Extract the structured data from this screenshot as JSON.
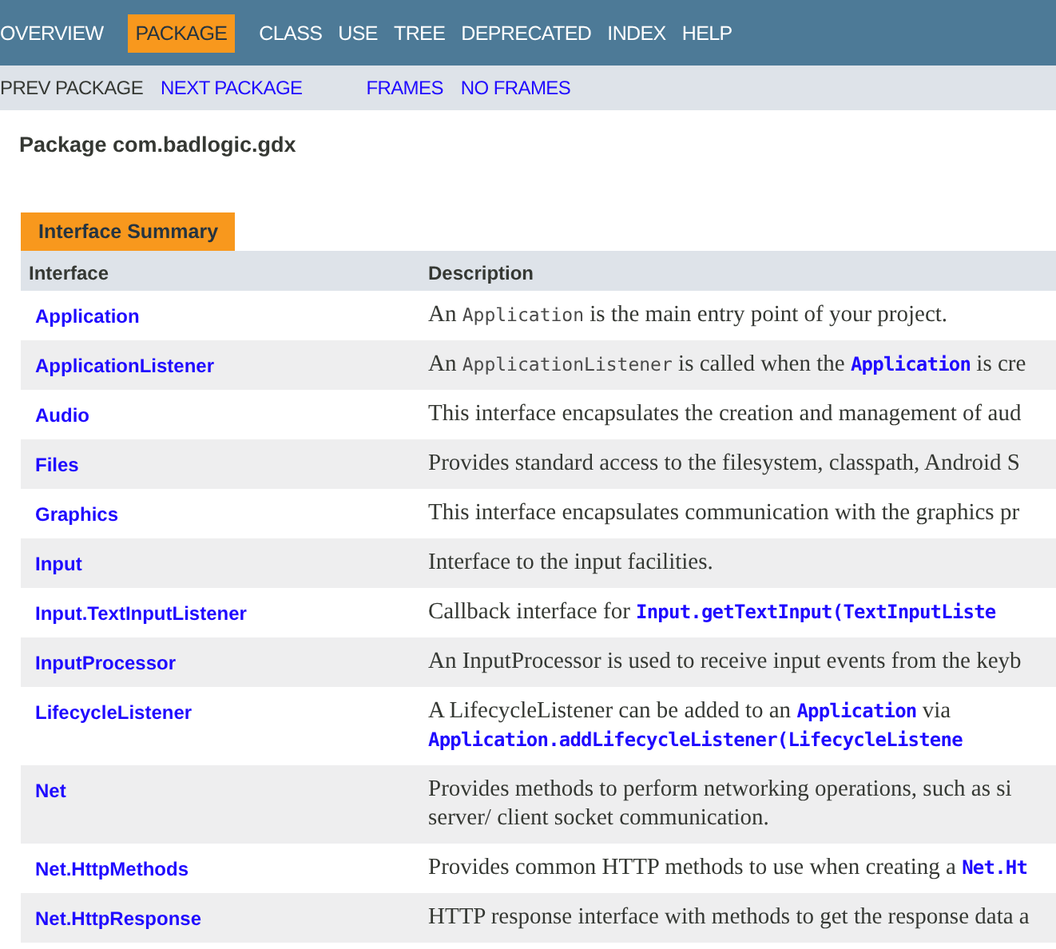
{
  "top_nav": [
    {
      "label": "OVERVIEW",
      "selected": false
    },
    {
      "label": "PACKAGE",
      "selected": true
    },
    {
      "label": "CLASS",
      "selected": false
    },
    {
      "label": "USE",
      "selected": false
    },
    {
      "label": "TREE",
      "selected": false
    },
    {
      "label": "DEPRECATED",
      "selected": false
    },
    {
      "label": "INDEX",
      "selected": false
    },
    {
      "label": "HELP",
      "selected": false
    }
  ],
  "sub_nav": [
    [
      {
        "label": "PREV PACKAGE",
        "disabled": true
      },
      {
        "label": "NEXT PACKAGE",
        "disabled": false
      }
    ],
    [
      {
        "label": "FRAMES",
        "disabled": false
      },
      {
        "label": "NO FRAMES",
        "disabled": false
      }
    ]
  ],
  "page_title": "Package com.badlogic.gdx",
  "summary": {
    "tab": "Interface Summary",
    "columns": [
      "Interface",
      "Description"
    ],
    "rows": [
      {
        "name": "Application",
        "description": [
          [
            {
              "kind": "text",
              "text": "An "
            },
            {
              "kind": "code",
              "text": "Application"
            },
            {
              "kind": "text",
              "text": " is the main entry point of your project."
            }
          ]
        ]
      },
      {
        "name": "ApplicationListener",
        "description": [
          [
            {
              "kind": "text",
              "text": "An "
            },
            {
              "kind": "code",
              "text": "ApplicationListener"
            },
            {
              "kind": "text",
              "text": " is called when the "
            },
            {
              "kind": "link",
              "text": "Application"
            },
            {
              "kind": "text",
              "text": " is cre"
            }
          ]
        ]
      },
      {
        "name": "Audio",
        "description": [
          [
            {
              "kind": "text",
              "text": "This interface encapsulates the creation and management of aud"
            }
          ]
        ]
      },
      {
        "name": "Files",
        "description": [
          [
            {
              "kind": "text",
              "text": "Provides standard access to the filesystem, classpath, Android S"
            }
          ]
        ]
      },
      {
        "name": "Graphics",
        "description": [
          [
            {
              "kind": "text",
              "text": "This interface encapsulates communication with the graphics pr"
            }
          ]
        ]
      },
      {
        "name": "Input",
        "description": [
          [
            {
              "kind": "text",
              "text": "Interface to the input facilities."
            }
          ]
        ]
      },
      {
        "name": "Input.TextInputListener",
        "description": [
          [
            {
              "kind": "text",
              "text": "Callback interface for "
            },
            {
              "kind": "link",
              "text": "Input.getTextInput(TextInputListe"
            }
          ]
        ]
      },
      {
        "name": "InputProcessor",
        "description": [
          [
            {
              "kind": "text",
              "text": "An InputProcessor is used to receive input events from the keyb"
            }
          ]
        ]
      },
      {
        "name": "LifecycleListener",
        "description": [
          [
            {
              "kind": "text",
              "text": "A LifecycleListener can be added to an "
            },
            {
              "kind": "link",
              "text": "Application"
            },
            {
              "kind": "text",
              "text": " via"
            }
          ],
          [
            {
              "kind": "link",
              "text": "Application.addLifecycleListener(LifecycleListene"
            }
          ]
        ]
      },
      {
        "name": "Net",
        "description": [
          [
            {
              "kind": "text",
              "text": "Provides methods to perform networking operations, such as si"
            }
          ],
          [
            {
              "kind": "text",
              "text": "server/ client socket communication."
            }
          ]
        ]
      },
      {
        "name": "Net.HttpMethods",
        "description": [
          [
            {
              "kind": "text",
              "text": "Provides common HTTP methods to use when creating a "
            },
            {
              "kind": "link",
              "text": "Net.Ht"
            }
          ]
        ]
      },
      {
        "name": "Net.HttpResponse",
        "description": [
          [
            {
              "kind": "text",
              "text": "HTTP response interface with methods to get the response data a"
            }
          ]
        ]
      }
    ]
  }
}
